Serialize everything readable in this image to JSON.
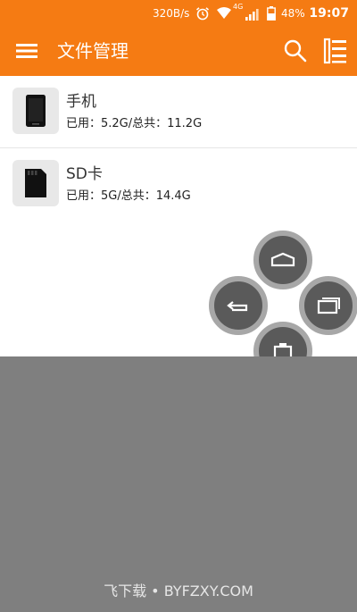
{
  "status_bar": {
    "net_speed": "320B/s",
    "network_type": "4G",
    "battery": "48%",
    "time": "19:07",
    "icons": [
      "alarm-icon",
      "wifi-icon",
      "signal-icon",
      "battery-icon"
    ]
  },
  "toolbar": {
    "title": "文件管理",
    "menu_icon": "menu-icon",
    "search_icon": "search-icon",
    "list_icon": "list-settings-icon"
  },
  "storage": [
    {
      "name": "手机",
      "usage": "已用：5.2G/总共：11.2G",
      "icon": "phone-icon"
    },
    {
      "name": "SD卡",
      "usage": "已用：5G/总共：14.4G",
      "icon": "sd-card-icon"
    }
  ],
  "floating_nav": {
    "buttons": [
      "home-icon",
      "back-icon",
      "recent-apps-icon",
      "notification-icon"
    ]
  },
  "watermark": "飞下载 • BYFZXY.COM",
  "colors": {
    "accent": "#f57b13",
    "overlay": "#7f7f7f"
  }
}
